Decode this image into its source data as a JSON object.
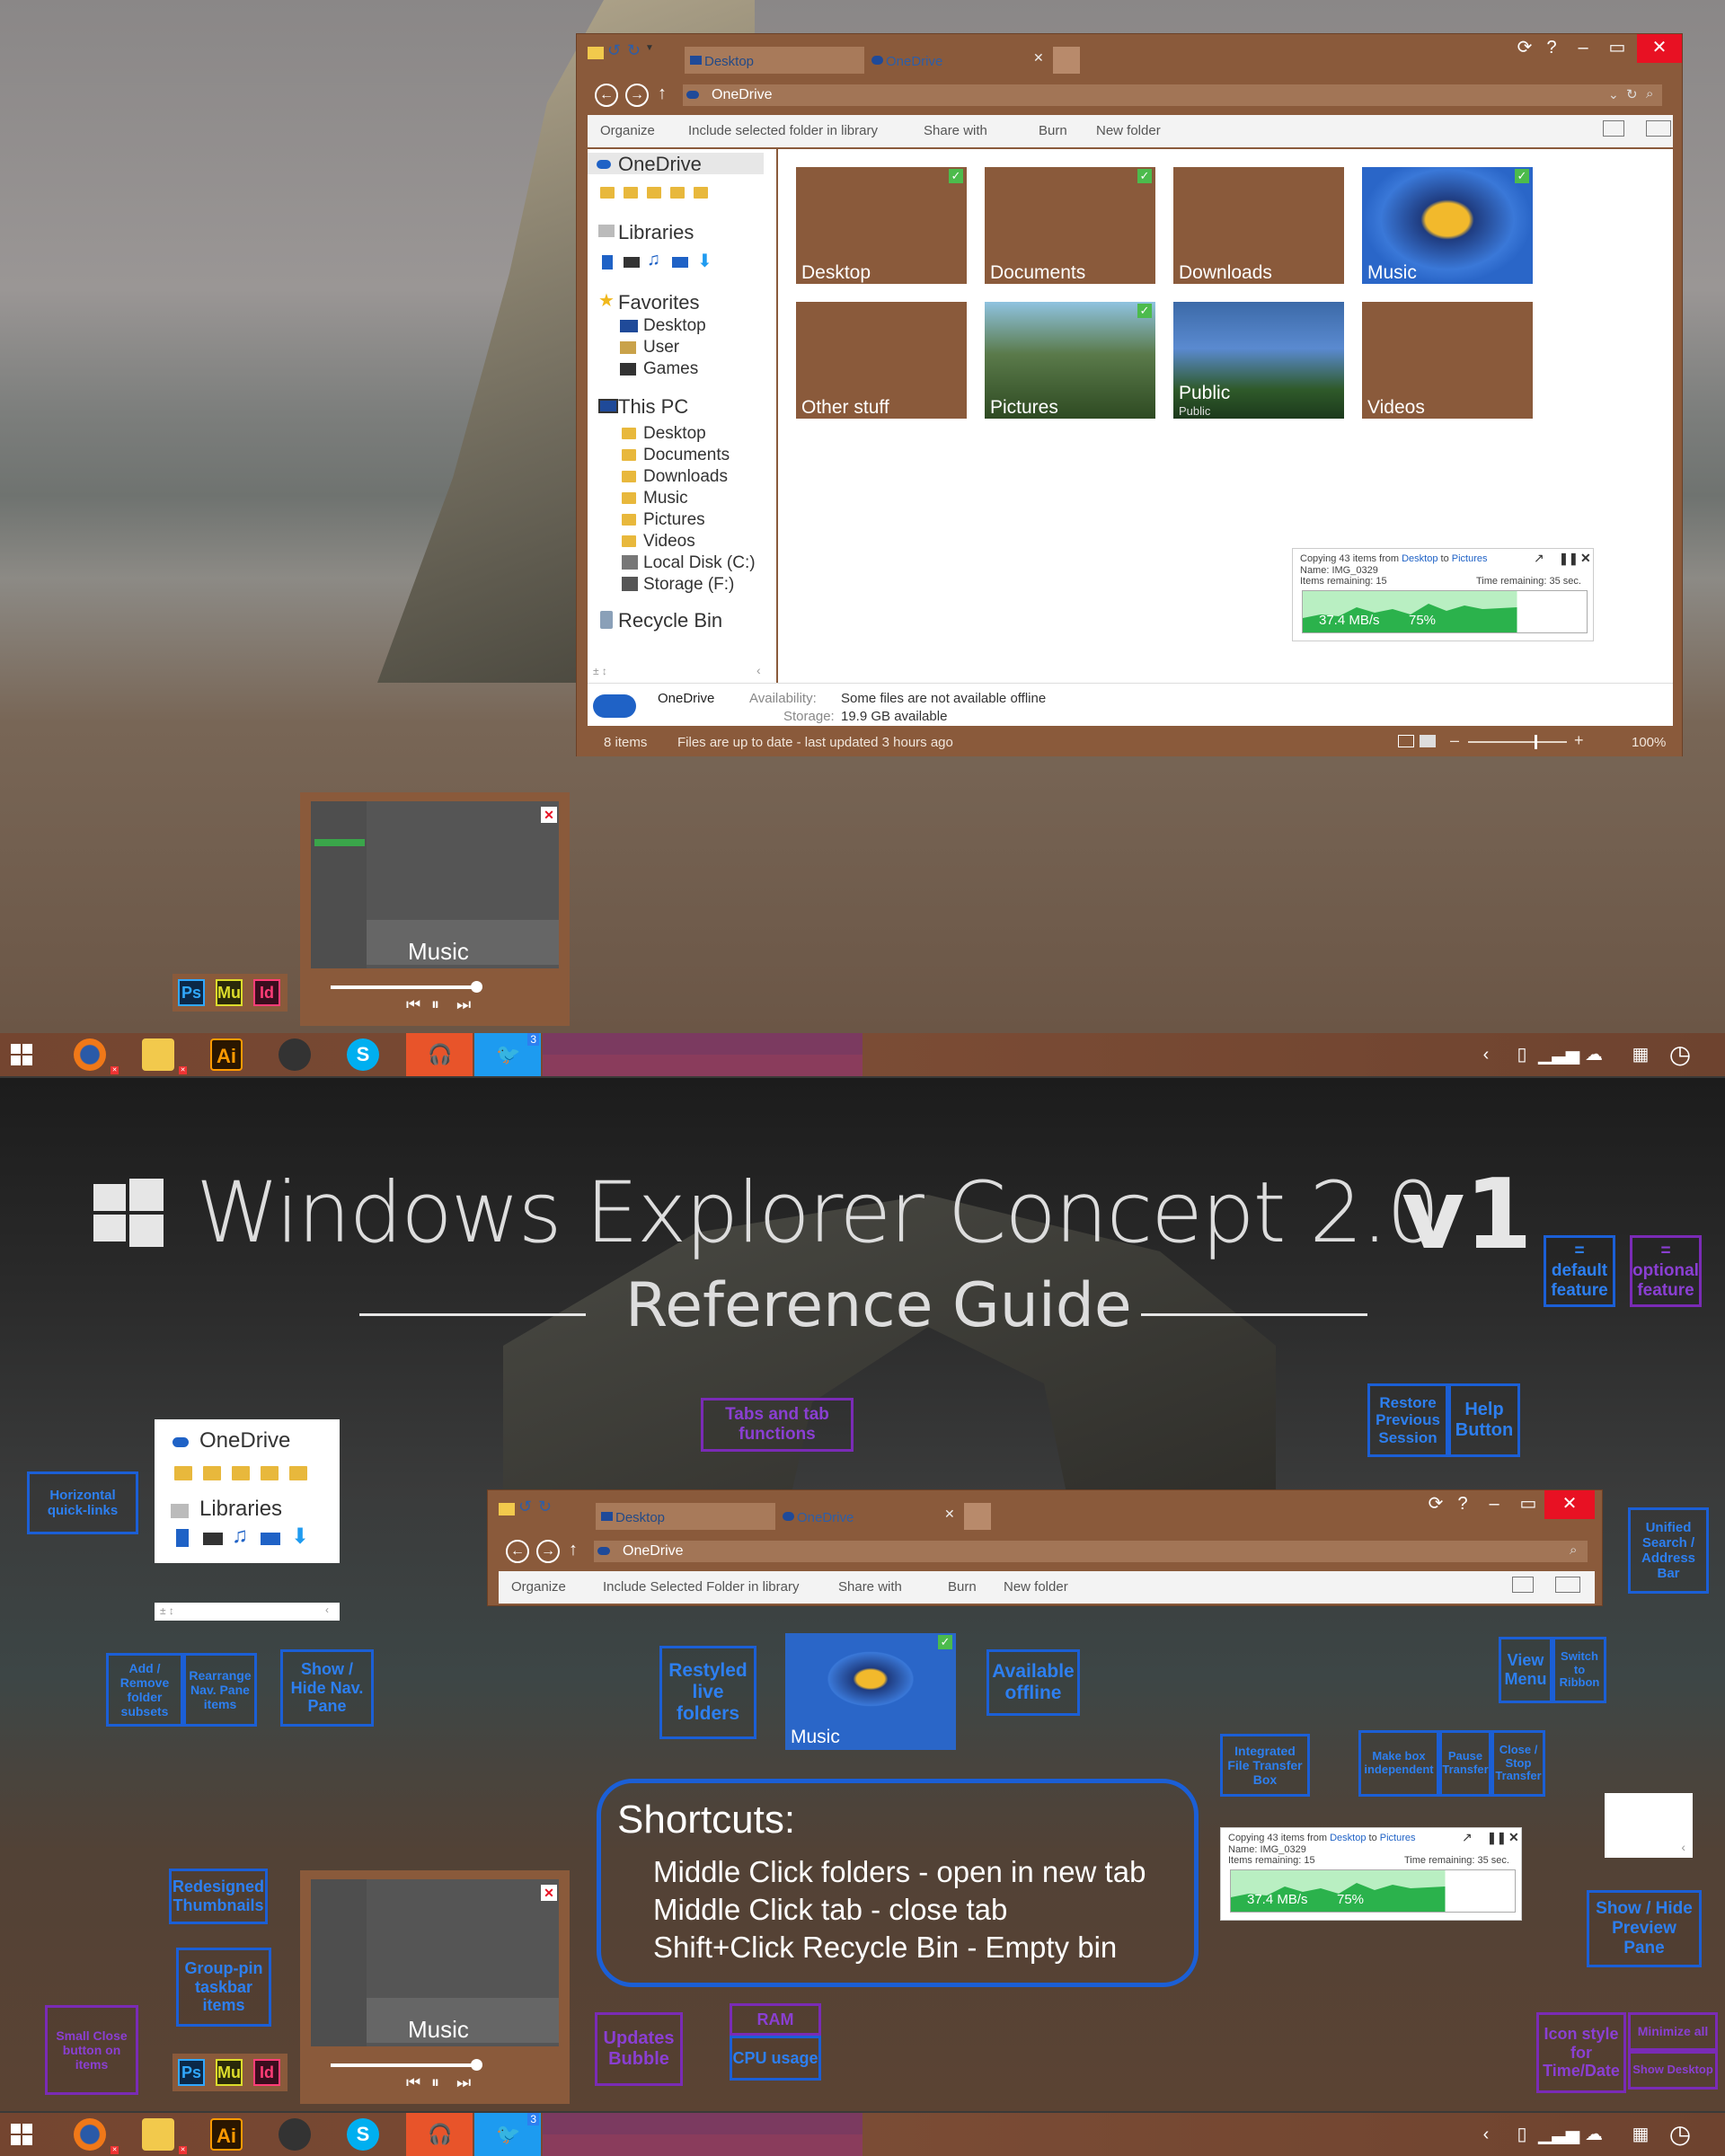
{
  "window": {
    "tabs": [
      "Desktop",
      "OneDrive"
    ],
    "address": "OneDrive",
    "ribbon": {
      "organize": "Organize",
      "include": "Include selected folder in library",
      "share": "Share with",
      "burn": "Burn",
      "newfolder": "New folder"
    },
    "nav": {
      "onedrive": "OneDrive",
      "libraries": "Libraries",
      "favorites": "Favorites",
      "fav_items": [
        "Desktop",
        "User",
        "Games"
      ],
      "thispc": "This PC",
      "pc_items": [
        "Desktop",
        "Documents",
        "Downloads",
        "Music",
        "Pictures",
        "Videos",
        "Local Disk (C:)",
        "Storage (F:)"
      ],
      "recycle": "Recycle Bin"
    },
    "tiles": [
      {
        "label": "Desktop",
        "sub": "",
        "checked": true
      },
      {
        "label": "Documents",
        "sub": "",
        "checked": true
      },
      {
        "label": "Downloads",
        "sub": "",
        "checked": false
      },
      {
        "label": "Music",
        "sub": "",
        "checked": true
      },
      {
        "label": "Other stuff",
        "sub": "",
        "checked": false
      },
      {
        "label": "Pictures",
        "sub": "",
        "checked": true
      },
      {
        "label": "Public",
        "sub": "Public",
        "checked": false
      },
      {
        "label": "Videos",
        "sub": "",
        "checked": false
      }
    ],
    "copy": {
      "line_prefix": "Copying 43 items from ",
      "from": "Desktop",
      "to_word": " to ",
      "to": "Pictures",
      "name": "Name: IMG_0329",
      "remaining": "Items remaining: 15",
      "time": "Time remaining: 35 sec.",
      "speed": "37.4 MB/s",
      "percent": "75%",
      "progress": 0.75
    },
    "details": {
      "name": "OneDrive",
      "avail_label": "Availability:",
      "avail_value": "Some files are not available offline",
      "storage_label": "Storage:",
      "storage_value": "19.9 GB available"
    },
    "status": {
      "items": "8 items",
      "updated": "Files are up to date - last updated 3 hours ago",
      "zoom": "100%"
    }
  },
  "window2": {
    "tabs": [
      "Desktop",
      "OneDrive"
    ],
    "address": "OneDrive",
    "ribbon": {
      "organize": "Organize",
      "include": "Include Selected Folder in library",
      "share": "Share with",
      "burn": "Burn",
      "newfolder": "New folder"
    }
  },
  "thumb": {
    "label": "Music",
    "header": "Libraries"
  },
  "taskbar": {
    "badge": "3",
    "pinned_group": [
      "Ps",
      "Mu",
      "Id"
    ],
    "ai": "Ai"
  },
  "guide": {
    "title_main": "Windows Explorer Concept 2.0",
    "title_ver": "v1",
    "subtitle": "Reference Guide",
    "nav_onedrive": "OneDrive",
    "nav_libraries": "Libraries",
    "music_tile": "Music",
    "legend_default": "=\ndefault\nfeature",
    "legend_optional": "=\noptional\nfeature",
    "callouts": {
      "horizontal": "Horizontal quick-links",
      "addremove": "Add / Remove folder subsets",
      "rearrange": "Rearrange Nav. Pane items",
      "showhide_nav": "Show / Hide Nav. Pane",
      "tabs": "Tabs and tab functions",
      "restore": "Restore Previous Session",
      "help": "Help Button",
      "unified": "Unified Search / Address Bar",
      "restyled": "Restyled live folders",
      "available": "Available offline",
      "view": "View Menu",
      "switch": "Switch to Ribbon",
      "integrated": "Integrated File Transfer Box",
      "makebox": "Make box independent",
      "pause": "Pause Transfer",
      "close": "Close / Stop Transfer",
      "preview": "Show / Hide Preview Pane",
      "redesigned": "Redesigned Thumbnails",
      "grouppin": "Group-pin taskbar items",
      "small": "Small Close button on items",
      "updates": "Updates Bubble",
      "ram": "RAM",
      "cpu": "CPU usage",
      "iconstyle": "Icon style for Time/Date",
      "minall": "Minimize all",
      "showdesk": "Show Desktop"
    },
    "shortcuts": {
      "title": "Shortcuts:",
      "lines": [
        "Middle Click folders - open in new tab",
        "Middle Click tab - close tab",
        "Shift+Click Recycle Bin - Empty bin"
      ]
    }
  },
  "colors": {
    "accent": "#8a5a3b",
    "callout_default": "#1b5fd6",
    "callout_optional": "#7a2bb6",
    "close": "#e81123",
    "transfer": "#2bb24c"
  }
}
